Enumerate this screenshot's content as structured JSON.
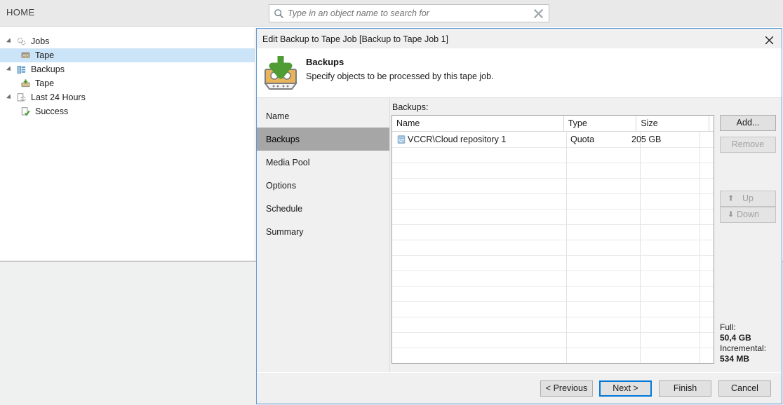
{
  "window": {
    "ribbon_tab": "HOME",
    "search": {
      "placeholder": "Type in an object name to search for",
      "value": "",
      "icon": "search-icon",
      "clear_icon": "close-icon"
    }
  },
  "sidebar": {
    "items": [
      {
        "label": "Jobs",
        "icon": "jobs-gears-icon",
        "level": 0,
        "expander": true,
        "selected": false
      },
      {
        "label": "Tape",
        "icon": "tape-drive-icon",
        "level": 1,
        "expander": false,
        "selected": true
      },
      {
        "label": "Backups",
        "icon": "backups-disk-icon",
        "level": 0,
        "expander": true,
        "selected": false
      },
      {
        "label": "Tape",
        "icon": "tape-backup-icon",
        "level": 1,
        "expander": false,
        "selected": false
      },
      {
        "label": "Last 24 Hours",
        "icon": "history-gear-icon",
        "level": 0,
        "expander": true,
        "selected": false
      },
      {
        "label": "Success",
        "icon": "success-check-icon",
        "level": 1,
        "expander": false,
        "selected": false
      }
    ]
  },
  "dialog": {
    "title": "Edit Backup to Tape Job [Backup to Tape Job 1]",
    "close_icon": "close-icon",
    "header": {
      "icon": "tape-cassette-download-icon",
      "title": "Backups",
      "subtitle": "Specify objects to be processed by this tape job."
    },
    "steps": [
      {
        "label": "Name",
        "active": false
      },
      {
        "label": "Backups",
        "active": true
      },
      {
        "label": "Media Pool",
        "active": false
      },
      {
        "label": "Options",
        "active": false
      },
      {
        "label": "Schedule",
        "active": false
      },
      {
        "label": "Summary",
        "active": false
      }
    ],
    "content": {
      "list_label": "Backups:",
      "columns": [
        "Name",
        "Type",
        "Size",
        ""
      ],
      "rows": [
        {
          "name": "VCCR\\Cloud repository 1",
          "type": "Quota",
          "size": "205 GB",
          "icon": "cloud-repository-icon"
        }
      ],
      "buttons": [
        {
          "label": "Add...",
          "enabled": true
        },
        {
          "label": "Remove",
          "enabled": false
        },
        {
          "label": "Up",
          "enabled": false,
          "icon": "arrow-up-icon"
        },
        {
          "label": "Down",
          "enabled": false,
          "icon": "arrow-down-icon"
        }
      ],
      "summary": {
        "full_label": "Full:",
        "full_value": "50,4 GB",
        "incremental_label": "Incremental:",
        "incremental_value": "534 MB"
      }
    },
    "footer": {
      "previous": "< Previous",
      "next": "Next >",
      "finish": "Finish",
      "cancel": "Cancel"
    }
  },
  "colors": {
    "accent": "#0078d7",
    "dialog_border": "#5b9bd5",
    "selection": "#cce4f7",
    "step_active": "#a6a6a6"
  }
}
